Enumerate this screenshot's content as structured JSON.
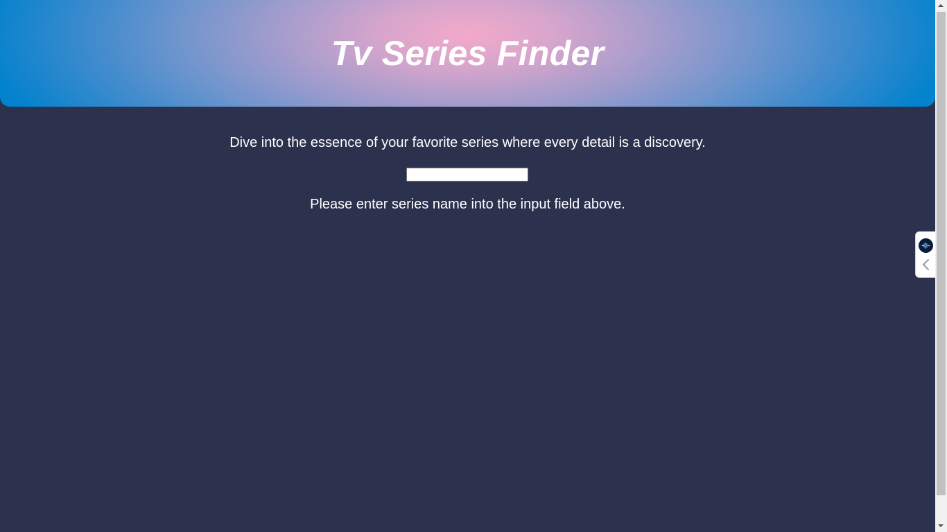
{
  "header": {
    "title": "Tv Series Finder"
  },
  "main": {
    "tagline": "Dive into the essence of your favorite series where every detail is a discovery.",
    "search": {
      "value": "",
      "placeholder": ""
    },
    "hint": "Please enter series name into the input field above."
  },
  "side_widget": {
    "logo_icon": "waveform-logo-icon",
    "collapse_icon": "chevron-left-icon"
  },
  "colors": {
    "page_background": "#2c324e",
    "header_gradient_center": "#f3a9c9",
    "header_gradient_edge": "#0382cd",
    "text": "#ffffff"
  }
}
